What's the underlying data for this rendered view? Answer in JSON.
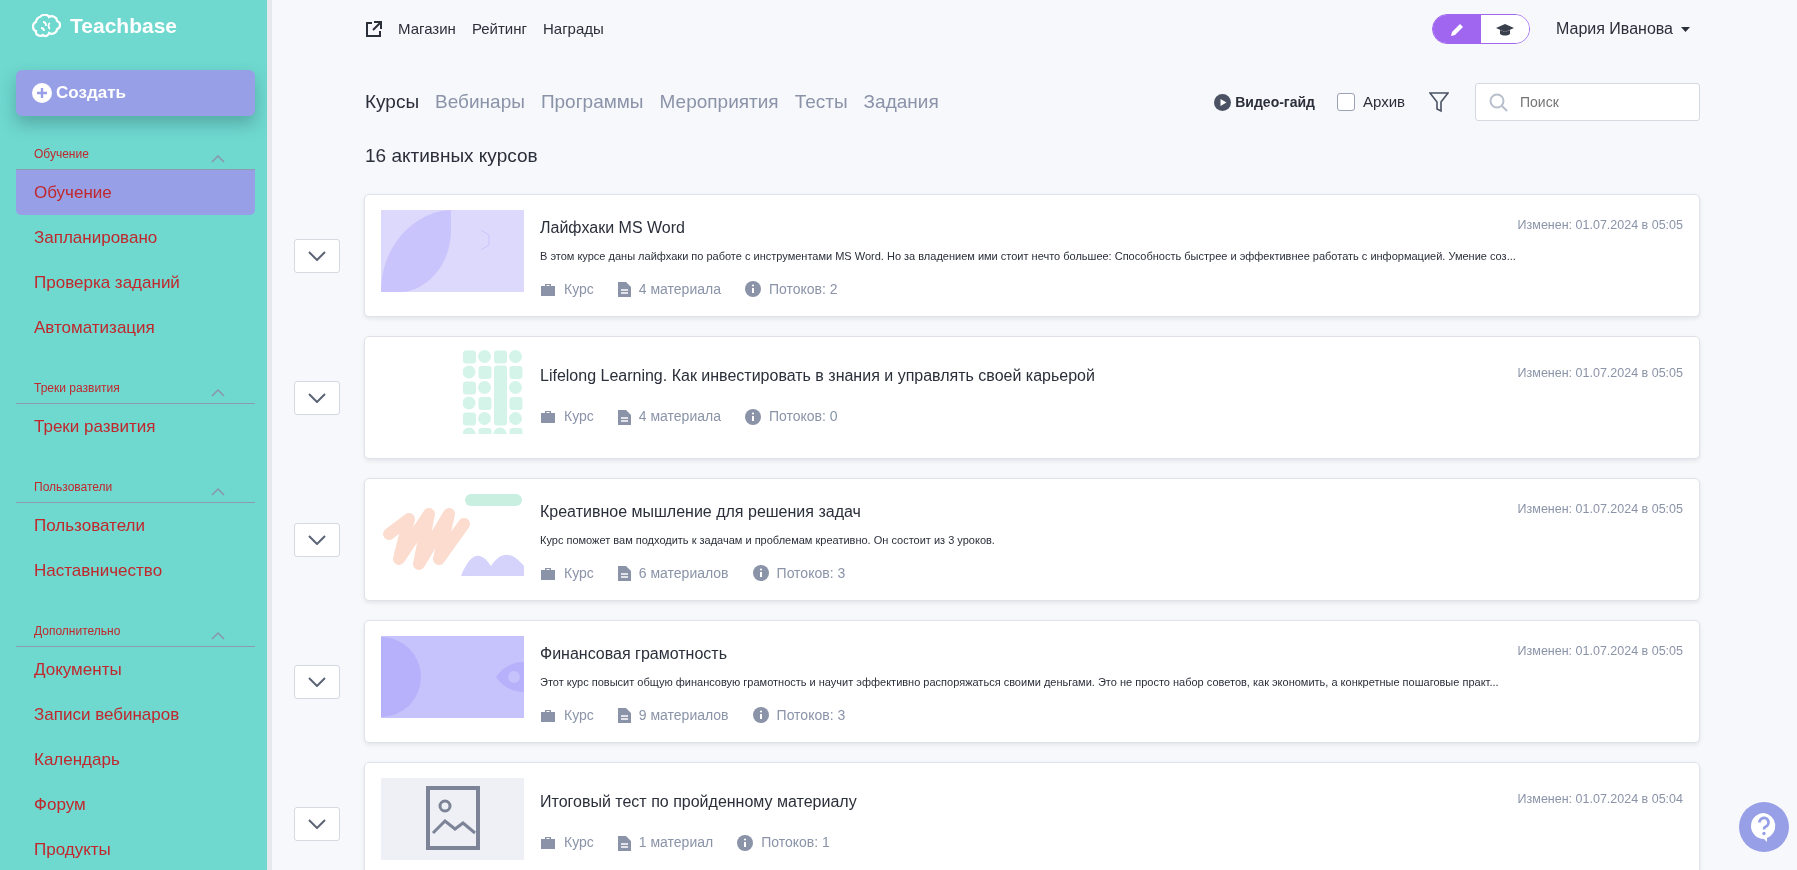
{
  "logo": {
    "text": "Teachbase"
  },
  "create_button": {
    "label": "Создать"
  },
  "sidebar": {
    "sections": [
      {
        "title": "Обучение",
        "expanded": true,
        "items": [
          {
            "label": "Обучение",
            "selected": true
          },
          {
            "label": "Запланировано",
            "selected": false
          },
          {
            "label": "Проверка заданий",
            "selected": false
          },
          {
            "label": "Автоматизация",
            "selected": false
          }
        ]
      },
      {
        "title": "Треки развития",
        "expanded": true,
        "items": [
          {
            "label": "Треки развития",
            "selected": false
          }
        ]
      },
      {
        "title": "Пользователи",
        "expanded": true,
        "items": [
          {
            "label": "Пользователи",
            "selected": false
          },
          {
            "label": "Наставничество",
            "selected": false
          }
        ]
      },
      {
        "title": "Дополнительно",
        "expanded": true,
        "items": [
          {
            "label": "Документы",
            "selected": false
          },
          {
            "label": "Записи вебинаров",
            "selected": false
          },
          {
            "label": "Календарь",
            "selected": false
          },
          {
            "label": "Форум",
            "selected": false
          },
          {
            "label": "Продукты",
            "selected": false
          }
        ]
      }
    ]
  },
  "top_links": [
    "Магазин",
    "Рейтинг",
    "Награды"
  ],
  "mode_toggle": [
    {
      "kind": "edit",
      "selected": true
    },
    {
      "kind": "learn",
      "selected": false
    }
  ],
  "user": {
    "name": "Мария Иванова"
  },
  "tabs": [
    {
      "label": "Курсы",
      "selected": true
    },
    {
      "label": "Вебинары",
      "selected": false
    },
    {
      "label": "Программы",
      "selected": false
    },
    {
      "label": "Мероприятия",
      "selected": false
    },
    {
      "label": "Тесты",
      "selected": false
    },
    {
      "label": "Задания",
      "selected": false
    }
  ],
  "video_guide": {
    "label": "Видео-гайд"
  },
  "archive": {
    "label": "Архив",
    "checked": false
  },
  "search": {
    "placeholder": "Поиск"
  },
  "heading": "16 активных курсов",
  "courses": [
    {
      "kind": "leaf",
      "title": "Лайфхаки MS Word",
      "modified": "Изменен: 01.07.2024 в 05:05",
      "description": "В этом курсе даны лайфхаки по работе с инструментами MS Word. Но за владением ими стоит нечто большее: Способность быстрее и эффективнее работать с информацией. Умение соз...",
      "type": "Курс",
      "materials": "4 материала",
      "streams": "Потоков: 2"
    },
    {
      "kind": "tiles",
      "title": "Lifelong Learning. Как инвестировать в знания и управлять своей карьерой",
      "modified": "Изменен: 01.07.2024 в 05:05",
      "type": "Курс",
      "materials": "4 материала",
      "streams": "Потоков: 0"
    },
    {
      "kind": "waves",
      "title": "Креативное мышление для решения задач",
      "modified": "Изменен: 01.07.2024 в 05:05",
      "description": "Курс поможет вам подходить к задачам и проблемам креативно. Он состоит из 3 уроков.",
      "type": "Курс",
      "materials": "6 материалов",
      "streams": "Потоков: 3"
    },
    {
      "kind": "eye",
      "title": "Финансовая грамотность",
      "modified": "Изменен: 01.07.2024 в 05:05",
      "description": "Этот курс повысит общую финансовую грамотность и научит эффективно распоряжаться своими деньгами. Это не просто набор советов, как экономить, а конкретные пошаговые практ...",
      "type": "Курс",
      "materials": "9 материалов",
      "streams": "Потоков: 3"
    },
    {
      "kind": "placeholder",
      "title": "Итоговый тест по пройденному материалу",
      "modified": "Изменен: 01.07.2024 в 05:04",
      "type": "Курс",
      "materials": "1 материал",
      "streams": "Потоков: 1"
    }
  ]
}
